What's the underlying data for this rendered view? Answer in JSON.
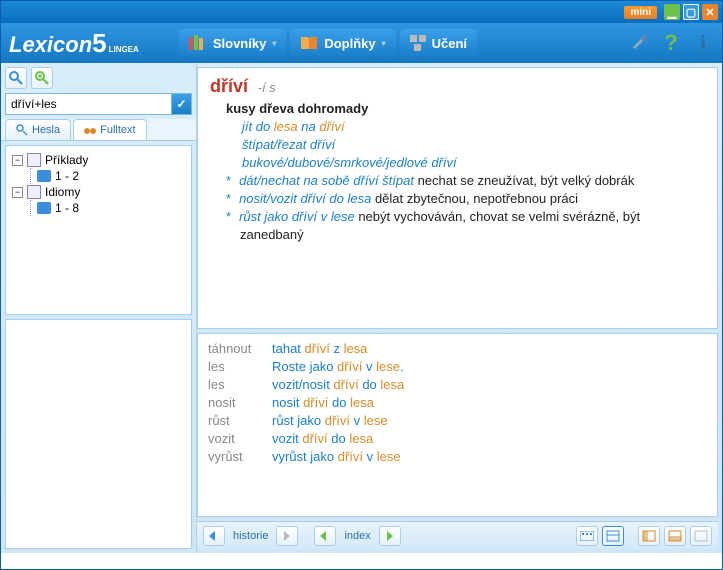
{
  "window": {
    "mini": "mini"
  },
  "logo": {
    "text": "Lexicon",
    "num": "5",
    "sup": "LINGEA"
  },
  "menu": {
    "dict": "Slovníky",
    "addons": "Doplňky",
    "learn": "Učení"
  },
  "search": {
    "value": "dříví+les",
    "tabs": {
      "hesla": "Hesla",
      "fulltext": "Fulltext"
    }
  },
  "tree": {
    "examples": {
      "label": "Příklady",
      "range": "1 - 2"
    },
    "idioms": {
      "label": "Idiomy",
      "range": "1 - 8"
    }
  },
  "entry": {
    "head": "dříví",
    "morph": "-í  s",
    "def": "kusy dřeva dohromady",
    "ex1_a": "jít do ",
    "ex1_b": "lesa",
    "ex1_c": " na ",
    "ex1_d": "dříví",
    "ex2": "štípat/řezat dříví",
    "ex3": "bukové/dubové/smrkové/jedlové dříví",
    "s1_i": "dát/nechat na sobě dříví štípat",
    "s1_t": "  nechat se zneužívat, být velký dobrák",
    "s2_i1": "nosit/vozit ",
    "s2_h": "dříví",
    "s2_i2": " do ",
    "s2_h2": "lesa",
    "s2_t": "  dělat zbytečnou, nepotřebnou práci",
    "s3_i1": "růst jako ",
    "s3_h": "dříví",
    "s3_i2": " v ",
    "s3_h2": "lese",
    "s3_t": "  nebýt vychováván, chovat se velmi svérázně, být zanedbaný"
  },
  "refs": [
    {
      "k": "táhnout",
      "a": "tahat ",
      "b": "dříví",
      "c": " z ",
      "d": "lesa",
      "e": ""
    },
    {
      "k": "les",
      "a": "Roste jako ",
      "b": "dříví",
      "c": " v ",
      "d": "lese",
      "e": "."
    },
    {
      "k": "les",
      "a": "vozit/nosit ",
      "b": "dříví",
      "c": " do ",
      "d": "lesa",
      "e": ""
    },
    {
      "k": "nosit",
      "a": "nosit ",
      "b": "dříví",
      "c": " do ",
      "d": "lesa",
      "e": ""
    },
    {
      "k": "růst",
      "a": "růst jako ",
      "b": "dříví",
      "c": " v ",
      "d": "lese",
      "e": ""
    },
    {
      "k": "vozit",
      "a": "vozit ",
      "b": "dříví",
      "c": " do ",
      "d": "lesa",
      "e": ""
    },
    {
      "k": "vyrůst",
      "a": "vyrůst jako ",
      "b": "dříví",
      "c": " v ",
      "d": "lese",
      "e": ""
    }
  ],
  "bottom": {
    "history": "historie",
    "index": "index"
  }
}
